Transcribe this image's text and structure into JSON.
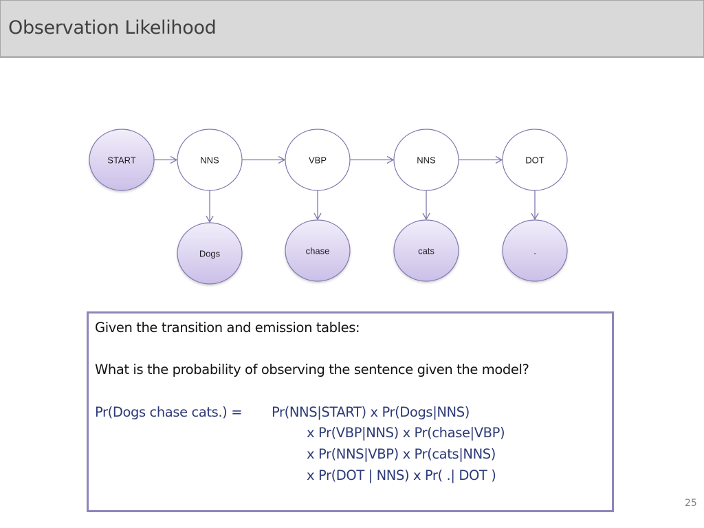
{
  "header": {
    "title": "Observation Likelihood"
  },
  "diagram": {
    "states": [
      {
        "id": "start",
        "label": "START",
        "shaded": true
      },
      {
        "id": "nns1",
        "label": "NNS",
        "shaded": false
      },
      {
        "id": "vbp",
        "label": "VBP",
        "shaded": false
      },
      {
        "id": "nns2",
        "label": "NNS",
        "shaded": false
      },
      {
        "id": "dot",
        "label": "DOT",
        "shaded": false
      }
    ],
    "observations": [
      {
        "id": "dogs",
        "label": "Dogs",
        "emitted_by": "nns1"
      },
      {
        "id": "chase",
        "label": "chase",
        "emitted_by": "vbp"
      },
      {
        "id": "cats",
        "label": "cats",
        "emitted_by": "nns2"
      },
      {
        "id": "period",
        "label": ".",
        "emitted_by": "dot"
      }
    ],
    "transitions": [
      {
        "from": "start",
        "to": "nns1"
      },
      {
        "from": "nns1",
        "to": "vbp"
      },
      {
        "from": "vbp",
        "to": "nns2"
      },
      {
        "from": "nns2",
        "to": "dot"
      }
    ],
    "colors": {
      "stroke": "#7f79ad",
      "shaded_fill_top": "#f1eefa",
      "shaded_fill_bottom": "#cbbfe8",
      "plain_fill": "#ffffff"
    }
  },
  "info_box": {
    "line1": "Given the transition and emission tables:",
    "line2": "What is the probability of observing the sentence given the model?",
    "equation": {
      "lhs": "Pr(Dogs chase cats.) =",
      "terms": [
        "Pr(NNS|START) x Pr(Dogs|NNS)",
        "x Pr(VBP|NNS) x Pr(chase|VBP)",
        "x Pr(NNS|VBP) x Pr(cats|NNS)",
        "x Pr(DOT | NNS) x Pr(  .| DOT )"
      ]
    }
  },
  "footer": {
    "page_number": "25"
  }
}
